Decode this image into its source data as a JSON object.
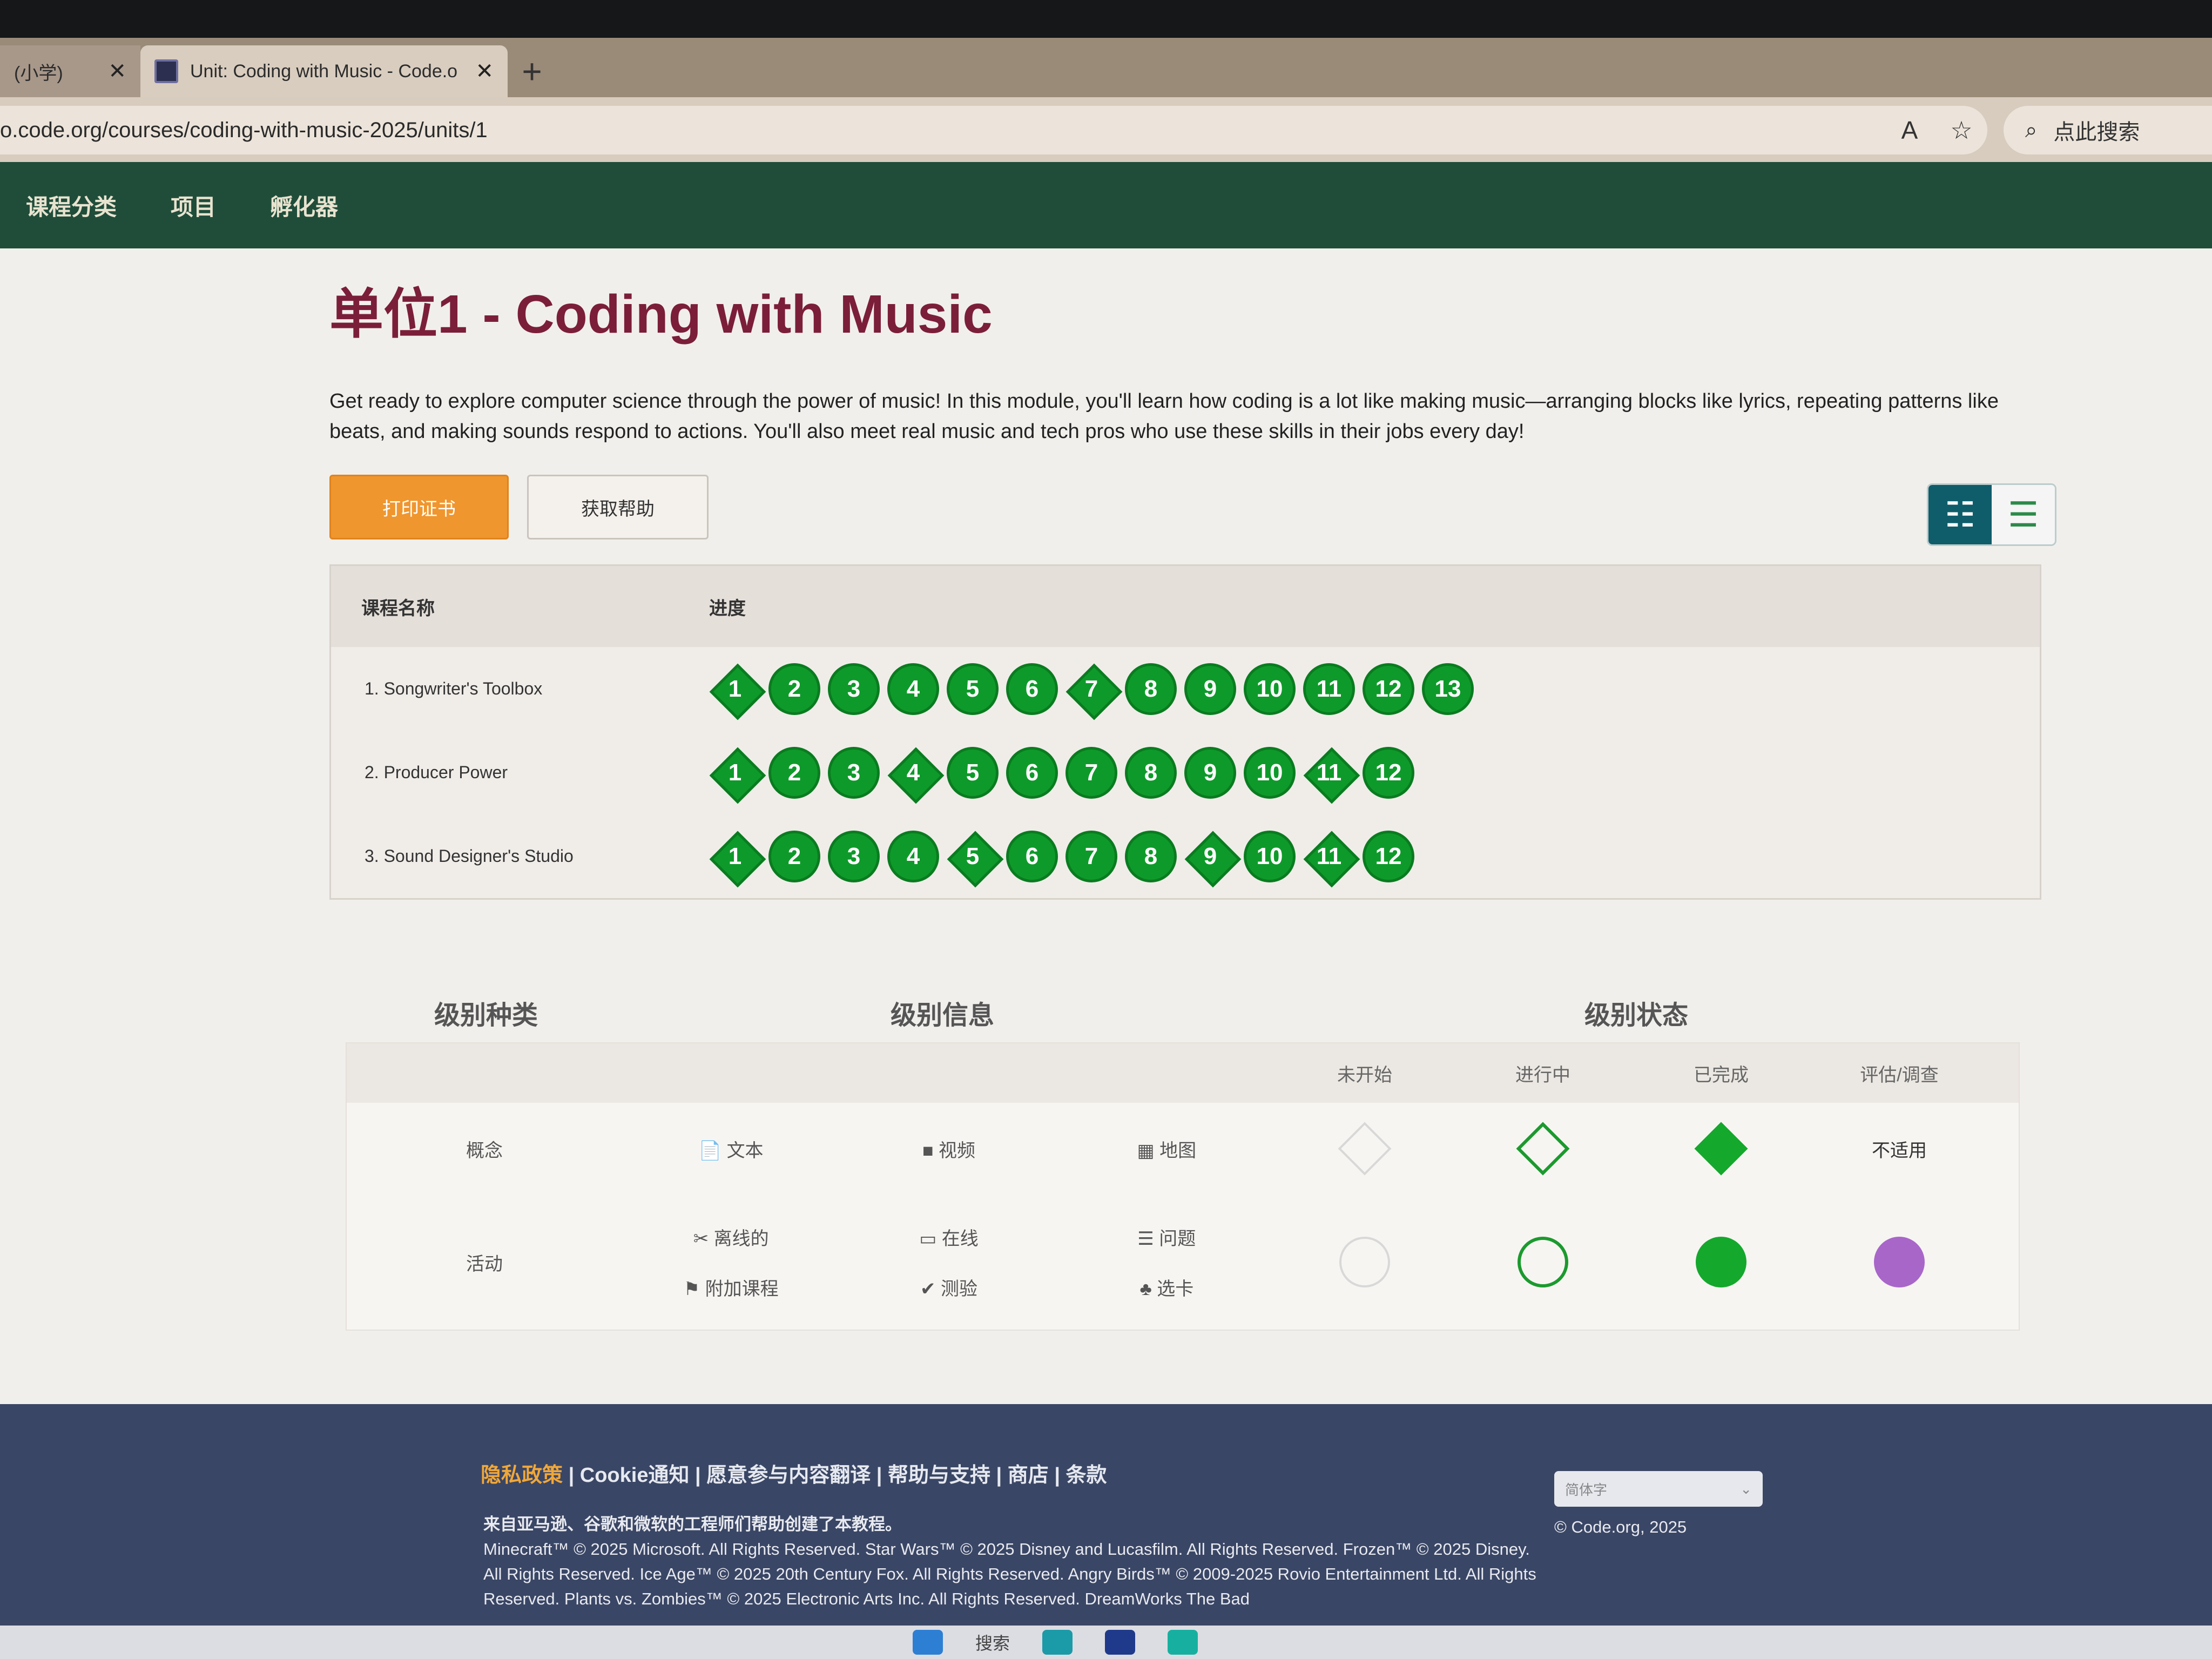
{
  "browser": {
    "tabs": [
      {
        "title": "(小学)",
        "close": "✕",
        "active": false
      },
      {
        "title": "Unit: Coding with Music - Code.o",
        "close": "✕",
        "active": true
      }
    ],
    "new_tab": "+",
    "url": "o.code.org/courses/coding-with-music-2025/units/1",
    "read_aloud_icon": "A",
    "favorite_icon": "☆",
    "search_icon": "⌕",
    "search_placeholder": "点此搜索"
  },
  "site_nav": {
    "items": [
      "课程分类",
      "项目",
      "孵化器"
    ]
  },
  "unit": {
    "title": "单位1 - Coding with Music",
    "description": "Get ready to explore computer science through the power of music! In this module, you'll learn how coding is a lot like making music—arranging blocks like lyrics, repeating patterns like beats, and making sounds respond to actions. You'll also meet real music and tech pros who use these skills in their jobs every day!",
    "print_button": "打印证书",
    "help_button": "获取帮助",
    "view_toggle": {
      "detail_icon": "☷",
      "list_icon": "☰"
    }
  },
  "progress_table": {
    "headers": {
      "name": "课程名称",
      "progress": "进度"
    },
    "lessons": [
      {
        "name": "1. Songwriter's Toolbox",
        "levels": [
          {
            "n": "1",
            "shape": "diamond"
          },
          {
            "n": "2",
            "shape": "circle"
          },
          {
            "n": "3",
            "shape": "circle"
          },
          {
            "n": "4",
            "shape": "circle"
          },
          {
            "n": "5",
            "shape": "circle"
          },
          {
            "n": "6",
            "shape": "circle"
          },
          {
            "n": "7",
            "shape": "diamond"
          },
          {
            "n": "8",
            "shape": "circle"
          },
          {
            "n": "9",
            "shape": "circle"
          },
          {
            "n": "10",
            "shape": "circle"
          },
          {
            "n": "11",
            "shape": "circle"
          },
          {
            "n": "12",
            "shape": "circle"
          },
          {
            "n": "13",
            "shape": "circle"
          }
        ]
      },
      {
        "name": "2. Producer Power",
        "levels": [
          {
            "n": "1",
            "shape": "diamond"
          },
          {
            "n": "2",
            "shape": "circle"
          },
          {
            "n": "3",
            "shape": "circle"
          },
          {
            "n": "4",
            "shape": "diamond"
          },
          {
            "n": "5",
            "shape": "circle"
          },
          {
            "n": "6",
            "shape": "circle"
          },
          {
            "n": "7",
            "shape": "circle"
          },
          {
            "n": "8",
            "shape": "circle"
          },
          {
            "n": "9",
            "shape": "circle"
          },
          {
            "n": "10",
            "shape": "circle"
          },
          {
            "n": "11",
            "shape": "diamond"
          },
          {
            "n": "12",
            "shape": "circle"
          }
        ]
      },
      {
        "name": "3. Sound Designer's Studio",
        "levels": [
          {
            "n": "1",
            "shape": "diamond"
          },
          {
            "n": "2",
            "shape": "circle"
          },
          {
            "n": "3",
            "shape": "circle"
          },
          {
            "n": "4",
            "shape": "circle"
          },
          {
            "n": "5",
            "shape": "diamond"
          },
          {
            "n": "6",
            "shape": "circle"
          },
          {
            "n": "7",
            "shape": "circle"
          },
          {
            "n": "8",
            "shape": "circle"
          },
          {
            "n": "9",
            "shape": "diamond"
          },
          {
            "n": "10",
            "shape": "circle"
          },
          {
            "n": "11",
            "shape": "diamond"
          },
          {
            "n": "12",
            "shape": "circle"
          }
        ]
      }
    ],
    "level_color": "#0e9a2a"
  },
  "legend": {
    "headings": {
      "kind": "级别种类",
      "info": "级别信息",
      "status": "级别状态"
    },
    "status_columns": [
      "未开始",
      "进行中",
      "已完成",
      "评估/调查"
    ],
    "concept": {
      "label": "概念",
      "items": [
        {
          "icon": "📄",
          "label": "文本"
        },
        {
          "icon": "■",
          "label": "视频"
        },
        {
          "icon": "▦",
          "label": "地图"
        }
      ],
      "not_applicable": "不适用"
    },
    "activity": {
      "label": "活动",
      "items": [
        {
          "icon": "✂",
          "label": "离线的"
        },
        {
          "icon": "▭",
          "label": "在线"
        },
        {
          "icon": "☰",
          "label": "问题"
        },
        {
          "icon": "⚑",
          "label": "附加课程"
        },
        {
          "icon": "✔",
          "label": "测验"
        },
        {
          "icon": "♣",
          "label": "选卡"
        }
      ]
    },
    "colors": {
      "complete": "#14a82d",
      "assessment": "#a866c9"
    }
  },
  "footer": {
    "links": [
      "隐私政策",
      "Cookie通知",
      "愿意参与内容翻译",
      "帮助与支持",
      "商店",
      "条款"
    ],
    "credit_cn": "来自亚马逊、谷歌和微软的工程师们帮助创建了本教程。",
    "credit_en": "Minecraft™ © 2025 Microsoft. All Rights Reserved. Star Wars™ © 2025 Disney and Lucasfilm. All Rights Reserved. Frozen™ © 2025 Disney. All Rights Reserved. Ice Age™ © 2025 20th Century Fox. All Rights Reserved. Angry Birds™ © 2009-2025 Rovio Entertainment Ltd. All Rights Reserved. Plants vs. Zombies™ © 2025 Electronic Arts Inc. All Rights Reserved. DreamWorks The Bad",
    "language": "简体字",
    "copyright": "© Code.org, 2025"
  },
  "taskbar": {
    "search": "搜索"
  }
}
